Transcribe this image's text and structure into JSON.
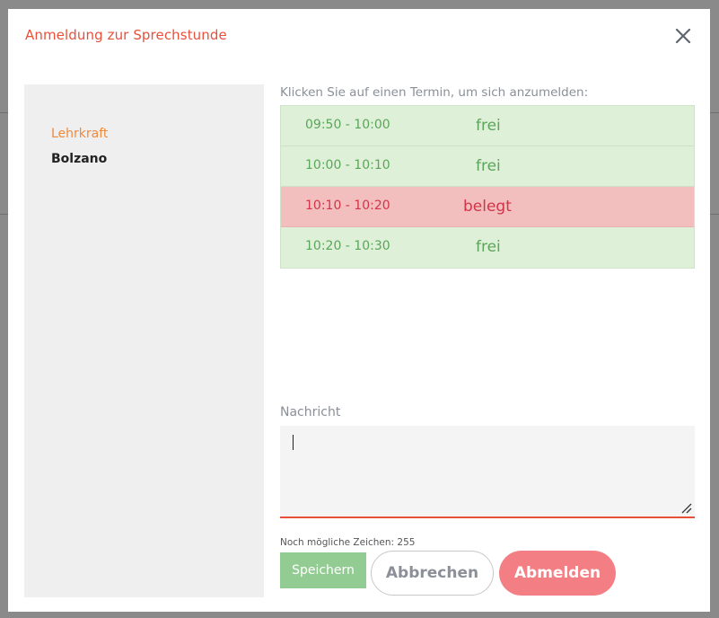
{
  "dialog": {
    "title": "Anmeldung zur Sprechstunde"
  },
  "teacher": {
    "label": "Lehrkraft",
    "name": "Bolzano"
  },
  "instruction": "Klicken Sie auf einen Termin, um sich anzumelden:",
  "slots": [
    {
      "time": "09:50 - 10:00",
      "status": "frei"
    },
    {
      "time": "10:00 - 10:10",
      "status": "frei"
    },
    {
      "time": "10:10 - 10:20",
      "status": "belegt"
    },
    {
      "time": "10:20 - 10:30",
      "status": "frei"
    }
  ],
  "message": {
    "label": "Nachricht",
    "value": "",
    "char_count_label": "Noch mögliche Zeichen: 255"
  },
  "buttons": {
    "save": "Speichern",
    "cancel": "Abbrechen",
    "signoff": "Abmelden"
  },
  "colors": {
    "accent": "#e8503a",
    "free_bg": "#dff0d8",
    "free_text": "#5aa55a",
    "busy_bg": "#f2bebe",
    "busy_text": "#d03548",
    "save_bg": "#93cc93",
    "signoff_bg": "#f37f84"
  },
  "icons": {
    "close": "close-icon",
    "resize": "resize-handle-icon"
  }
}
